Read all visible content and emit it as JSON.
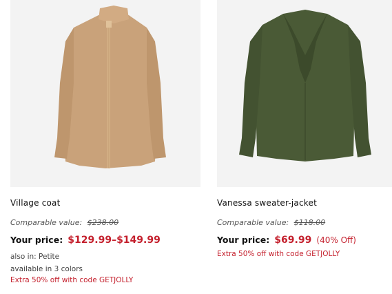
{
  "products": [
    {
      "name": "Village coat",
      "image_alt": "camel-coat-image",
      "comparable_label": "Comparable value:",
      "comparable_value": "$238.00",
      "your_price_label": "Your price:",
      "price": "$129.99–$149.99",
      "also_in": "also in: Petite",
      "available": "available in 3 colors",
      "promo": "Extra 50% off with code GETJOLLY",
      "color": "#c9a27a"
    },
    {
      "name": "Vanessa sweater-jacket",
      "image_alt": "green-sweater-jacket-image",
      "comparable_label": "Comparable value:",
      "comparable_value": "$118.00",
      "your_price_label": "Your price:",
      "price": "$69.99",
      "discount": "(40% Off)",
      "promo": "Extra 50% off with code GETJOLLY",
      "color": "#4a5a36"
    }
  ]
}
